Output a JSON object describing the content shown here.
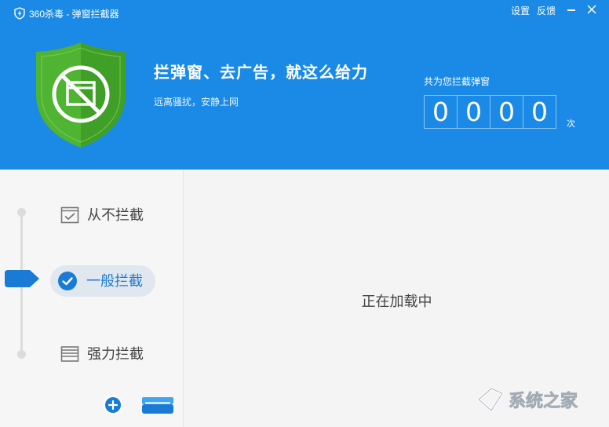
{
  "titlebar": {
    "app_title": "360杀毒 - 弹窗拦截器",
    "settings": "设置",
    "feedback": "反馈"
  },
  "banner": {
    "headline": "拦弹窗、去广告，就这么给力",
    "subline": "远离骚扰，安静上网",
    "counter_label": "共为您拦截弹窗",
    "counter_digits": [
      "0",
      "0",
      "0",
      "0"
    ],
    "counter_unit": "次"
  },
  "modes": {
    "never": "从不拦截",
    "normal": "一般拦截",
    "strong": "强力拦截",
    "selected": "normal"
  },
  "main": {
    "loading_text": "正在加载中"
  },
  "watermark": {
    "text": "系统之家"
  },
  "colors": {
    "header_blue": "#1a8ae6",
    "shield_green": "#5bbf3a",
    "accent_blue": "#1a7bd6"
  },
  "icons": {
    "app": "shield-bolt-icon",
    "close": "close-icon",
    "minimize": "minimize-icon",
    "shield": "blocked-popup-shield-icon",
    "never": "window-check-icon",
    "normal": "check-circle-icon",
    "strong": "window-layers-icon",
    "add": "plus-circle-icon",
    "tray": "tray-icon",
    "slider": "slider-handle-icon"
  }
}
